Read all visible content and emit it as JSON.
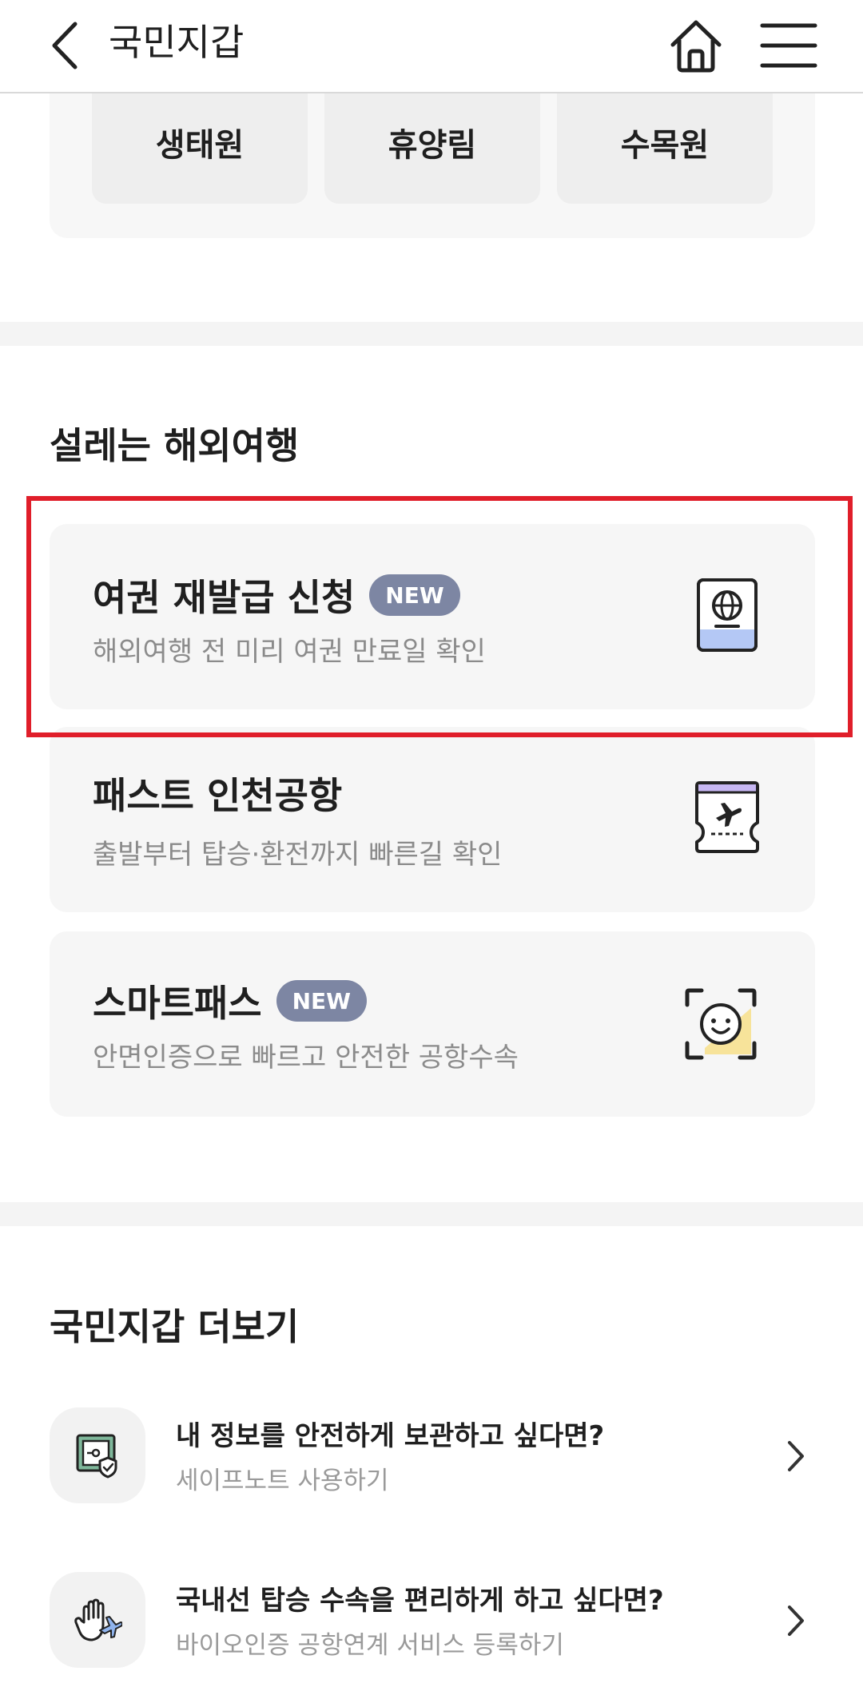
{
  "header": {
    "title": "국민지갑",
    "back_icon": "chevron-left-icon",
    "home_icon": "home-icon",
    "menu_icon": "hamburger-menu-icon"
  },
  "top_chips": [
    "생태원",
    "휴양림",
    "수목원"
  ],
  "travel_section": {
    "title": "설레는 해외여행",
    "cards": [
      {
        "title": "여권 재발급 신청",
        "badge": "NEW",
        "desc": "해외여행 전 미리 여권 만료일 확인",
        "icon": "passport-icon"
      },
      {
        "title": "패스트 인천공항",
        "badge": "",
        "desc": "출발부터 탑승·환전까지 빠른길 확인",
        "icon": "flight-ticket-icon"
      },
      {
        "title": "스마트패스",
        "badge": "NEW",
        "desc": "안면인증으로 빠르고 안전한 공항수속",
        "icon": "face-scan-icon"
      }
    ]
  },
  "more_section": {
    "title": "국민지갑 더보기",
    "items": [
      {
        "title": "내 정보를 안전하게 보관하고 싶다면?",
        "subtitle": "세이프노트 사용하기",
        "icon": "safe-note-icon"
      },
      {
        "title": "국내선 탑승 수속을 편리하게 하고 싶다면?",
        "subtitle": "바이오인증 공항연계 서비스 등록하기",
        "icon": "palm-airplane-icon"
      }
    ]
  },
  "colors": {
    "badge": "#7d86a3",
    "highlight": "#e01e2a",
    "card_bg": "#f6f6f6"
  }
}
